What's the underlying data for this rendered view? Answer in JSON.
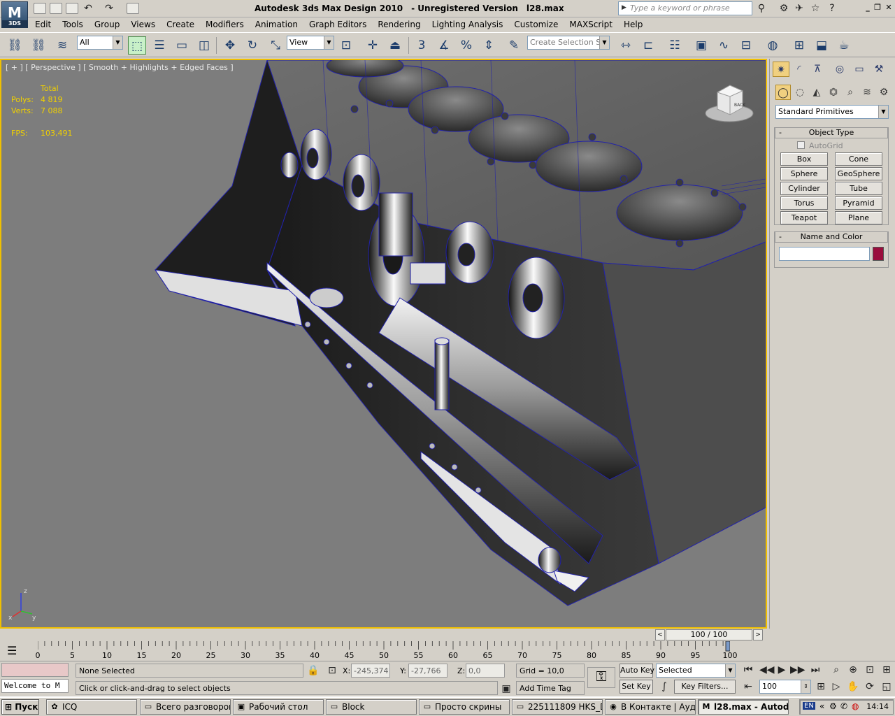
{
  "app": {
    "logo_text": "M",
    "logo_sub": "3DS",
    "title": {
      "product": "Autodesk 3ds Max Design 2010",
      "edition": "- Unregistered Version",
      "file": "l28.max"
    },
    "search_placeholder": "Type a keyword or phrase"
  },
  "menu": [
    "Edit",
    "Tools",
    "Group",
    "Views",
    "Create",
    "Modifiers",
    "Animation",
    "Graph Editors",
    "Rendering",
    "Lighting Analysis",
    "Customize",
    "MAXScript",
    "Help"
  ],
  "toolbar": {
    "filter_value": "All",
    "coord_system": "View",
    "snap_3": "3",
    "snap_percent": "%",
    "selection_set_placeholder": "Create Selection Se"
  },
  "viewport": {
    "label": "[ + ] [ Perspective ] [ Smooth + Highlights + Edged Faces ]",
    "stats_header": "Total",
    "polys_label": "Polys:",
    "polys_value": "4 819",
    "verts_label": "Verts:",
    "verts_value": "7 088",
    "fps_label": "FPS:",
    "fps_value": "103,491",
    "viewcube_face": "BACK",
    "axis": {
      "z": "z",
      "x": "x",
      "y": "y"
    }
  },
  "command_panel": {
    "category": "Standard Primitives",
    "object_type_title": "Object Type",
    "autogrid_label": "AutoGrid",
    "primitives": [
      "Box",
      "Cone",
      "Sphere",
      "GeoSphere",
      "Cylinder",
      "Tube",
      "Torus",
      "Pyramid",
      "Teapot",
      "Plane"
    ],
    "name_color_title": "Name and Color",
    "object_color": "#9a0d3c"
  },
  "timeline": {
    "frame_display": "100 / 100",
    "ticks": [
      "0",
      "5",
      "10",
      "15",
      "20",
      "25",
      "30",
      "35",
      "40",
      "45",
      "50",
      "55",
      "60",
      "65",
      "70",
      "75",
      "80",
      "85",
      "90",
      "95",
      "100"
    ]
  },
  "status": {
    "maxscript_listener": "Welcome to M",
    "selection": "None Selected",
    "prompt": "Click or click-and-drag to select objects",
    "x_label": "X:",
    "x_value": "-245,374",
    "y_label": "Y:",
    "y_value": "-27,766",
    "z_label": "Z:",
    "z_value": "0,0",
    "grid": "Grid = 10,0",
    "add_time_tag": "Add Time Tag",
    "auto_key": "Auto Key",
    "set_key": "Set Key",
    "key_mode": "Selected",
    "key_filters": "Key Filters...",
    "current_frame": "100"
  },
  "taskbar": {
    "start": "Пуск",
    "tasks": [
      {
        "label": "ICQ",
        "icon": "icq-icon",
        "active": false
      },
      {
        "label": "Всего разговоров...",
        "icon": "folder-icon",
        "active": false
      },
      {
        "label": "Рабочий стол",
        "icon": "desktop-icon",
        "active": false
      },
      {
        "label": "Block",
        "icon": "folder-icon",
        "active": false
      },
      {
        "label": "Просто скрины",
        "icon": "folder-icon",
        "active": false
      },
      {
        "label": "225111809 HKS_D...",
        "icon": "folder-icon",
        "active": false
      },
      {
        "label": "В Контакте | Ауд...",
        "icon": "browser-icon",
        "active": false
      },
      {
        "label": "l28.max - Autod...",
        "icon": "3dsmax-icon",
        "active": true
      }
    ],
    "lang": "EN",
    "clock": "14:14"
  }
}
